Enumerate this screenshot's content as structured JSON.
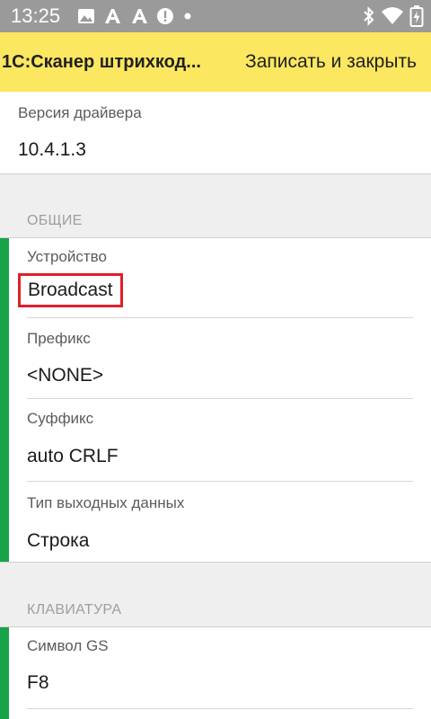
{
  "status_bar": {
    "time": "13:25",
    "left_icons": [
      "image-icon",
      "font-a-icon",
      "font-a-icon",
      "alert-icon",
      "dot-icon"
    ],
    "right_icons": [
      "bluetooth-icon",
      "wifi-icon",
      "battery-charging-icon"
    ]
  },
  "app_bar": {
    "title": "1С:Сканер штрихкод...",
    "save_close_label": "Записать и закрыть",
    "color": "#fbe760"
  },
  "driver": {
    "label": "Версия драйвера",
    "value": "10.4.1.3"
  },
  "general": {
    "header": "ОБЩИЕ",
    "fields": [
      {
        "label": "Устройство",
        "value": "Broadcast"
      },
      {
        "label": "Префикс",
        "value": "<NONE>"
      },
      {
        "label": "Суффикс",
        "value": "auto CRLF"
      },
      {
        "label": "Тип выходных данных",
        "value": "Строка"
      }
    ]
  },
  "keyboard": {
    "header": "КЛАВИАТУРА",
    "fields": [
      {
        "label": "Символ GS",
        "value": "F8"
      }
    ]
  },
  "colors": {
    "accent_green": "#18a34a",
    "highlight_red": "#e01f2a"
  }
}
